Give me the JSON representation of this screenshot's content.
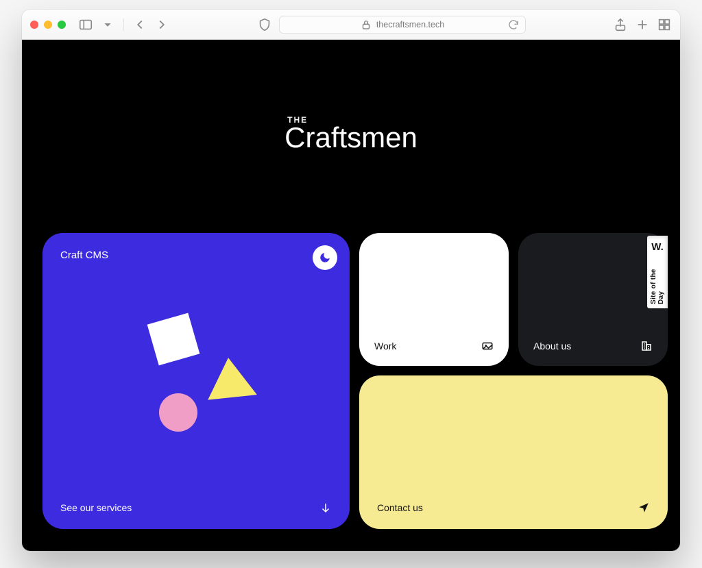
{
  "browser": {
    "url_display": "thecraftsmen.tech"
  },
  "logo": {
    "overline": "THE",
    "brand": "Craftsmen"
  },
  "cards": {
    "craft": {
      "title": "Craft CMS",
      "cta": "See our services"
    },
    "work": {
      "label": "Work"
    },
    "about": {
      "label": "About us"
    },
    "contact": {
      "label": "Contact us"
    }
  },
  "ribbon": {
    "monogram": "W.",
    "text": "Site of the Day"
  }
}
